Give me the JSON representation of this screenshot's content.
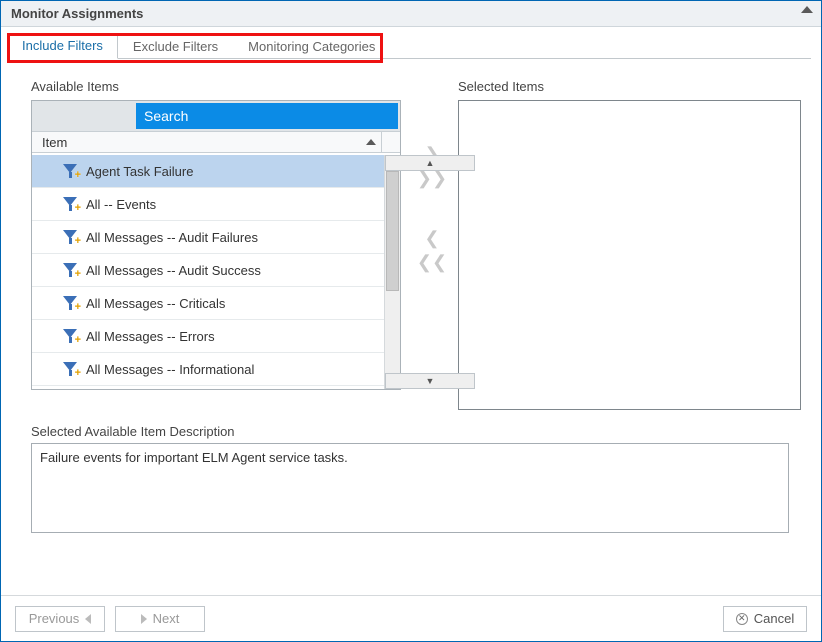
{
  "window": {
    "title": "Monitor Assignments"
  },
  "tabs": [
    {
      "label": "Include Filters",
      "active": true
    },
    {
      "label": "Exclude Filters",
      "active": false
    },
    {
      "label": "Monitoring Categories",
      "active": false
    }
  ],
  "available": {
    "label": "Available Items",
    "search_placeholder": "Search",
    "column_header": "Item",
    "items": [
      {
        "label": "Agent Task Failure",
        "selected": true
      },
      {
        "label": "All -- Events",
        "selected": false
      },
      {
        "label": "All Messages -- Audit Failures",
        "selected": false
      },
      {
        "label": "All Messages -- Audit Success",
        "selected": false
      },
      {
        "label": "All Messages -- Criticals",
        "selected": false
      },
      {
        "label": "All Messages -- Errors",
        "selected": false
      },
      {
        "label": "All Messages -- Informational",
        "selected": false
      }
    ]
  },
  "selected": {
    "label": "Selected Items"
  },
  "description": {
    "label": "Selected Available Item Description",
    "text": "Failure events for important ELM Agent service tasks."
  },
  "movers": {
    "add": "❯",
    "addAll": "❯❯",
    "remove": "❮",
    "removeAll": "❮❮"
  },
  "footer": {
    "previous": "Previous",
    "next": "Next",
    "cancel": "Cancel"
  }
}
